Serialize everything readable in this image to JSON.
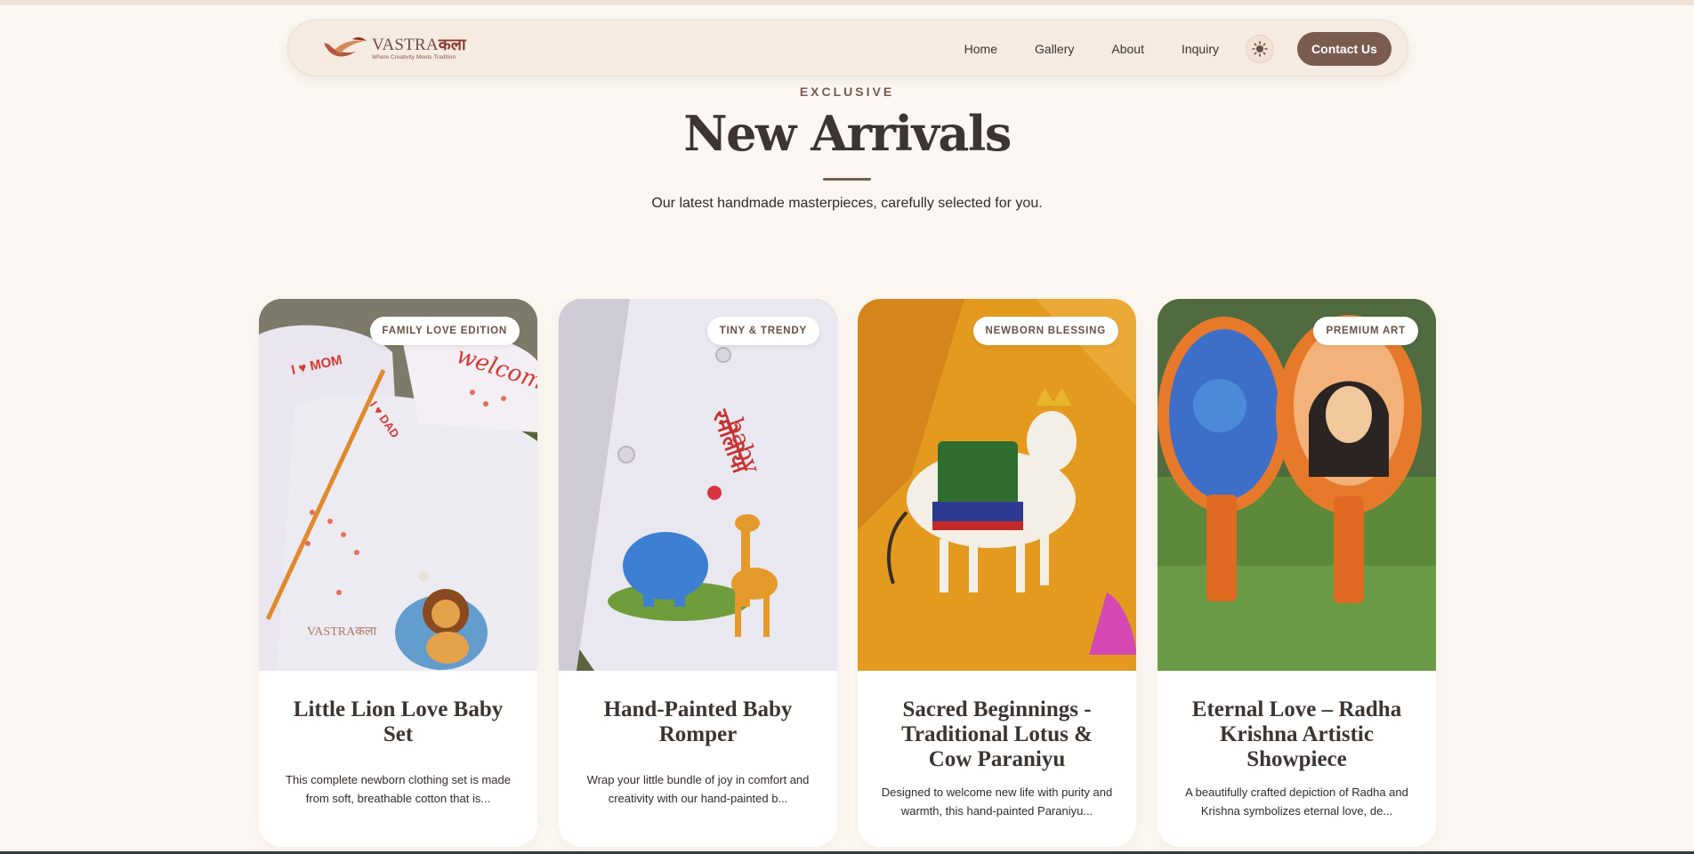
{
  "brand": {
    "name_latin": "VASTRA",
    "name_devanagari": "कला",
    "tagline": "Where Creativity Meets Tradition"
  },
  "nav": {
    "links": [
      "Home",
      "Gallery",
      "About",
      "Inquiry"
    ],
    "theme_toggle_icon": "sun-icon",
    "contact_label": "Contact Us"
  },
  "section": {
    "eyebrow": "EXCLUSIVE",
    "title": "New Arrivals",
    "subtitle": "Our latest handmade masterpieces, carefully selected for you."
  },
  "products": [
    {
      "badge": "FAMILY LOVE EDITION",
      "title": "Little Lion Love Baby Set",
      "description": "This complete newborn clothing set is made from soft, breathable cotton that is...",
      "image_labels": [
        "I ♥ MOM",
        "I ♥ DAD",
        "welcome"
      ],
      "watermark": "VASTRAकला"
    },
    {
      "badge": "TINY & TRENDY",
      "title": "Hand-Painted Baby Romper",
      "description": "Wrap your little bundle of joy in comfort and creativity with our hand-painted b...",
      "image_labels": [
        "baby",
        "रमोलीया"
      ]
    },
    {
      "badge": "NEWBORN BLESSING",
      "title": "Sacred Beginnings - Traditional Lotus & Cow Paraniyu",
      "description": "Designed to welcome new life with purity and warmth, this hand-painted Paraniyu..."
    },
    {
      "badge": "PREMIUM ART",
      "title": "Eternal Love – Radha Krishna Artistic Showpiece",
      "description": "A beautifully crafted depiction of Radha and Krishna symbolizes eternal love, de..."
    }
  ],
  "colors": {
    "page_bg": "#fcf7f2",
    "nav_bg": "#f6ebe1",
    "accent": "#7a5b50",
    "heading": "#3c3531"
  }
}
